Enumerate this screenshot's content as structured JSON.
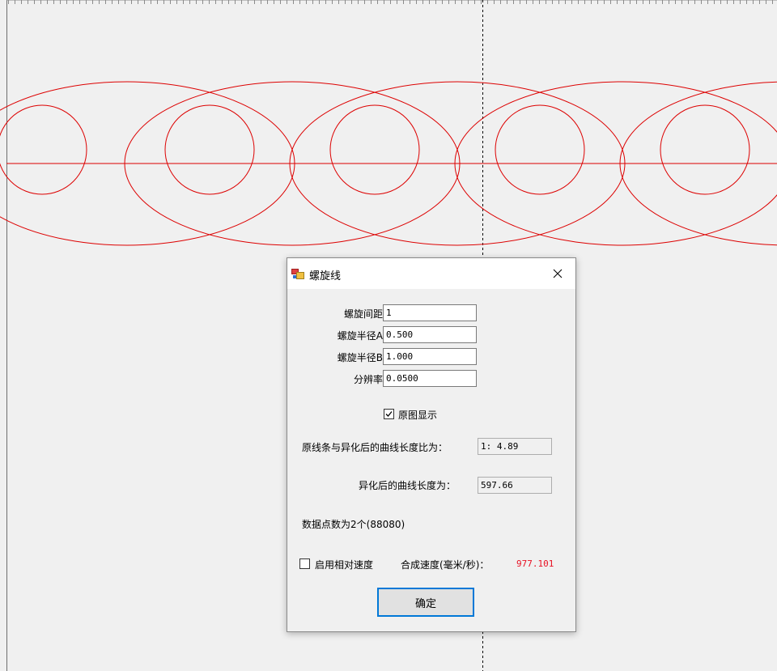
{
  "dialog": {
    "title": "螺旋线",
    "fields": [
      {
        "label": "螺旋间距",
        "value": "1"
      },
      {
        "label": "螺旋半径A",
        "value": "0.500"
      },
      {
        "label": "螺旋半径B",
        "value": "1.000"
      },
      {
        "label": "分辨率",
        "value": "0.0500"
      }
    ],
    "show_original": {
      "label": "原图显示",
      "checked": true
    },
    "ratio": {
      "label": "原线条与异化后的曲线长度比为：",
      "value": "1: 4.89"
    },
    "length": {
      "label": "异化后的曲线长度为：",
      "value": "597.66"
    },
    "points": "数据点数为2个(88080)",
    "relative_speed": {
      "label": "启用相对速度",
      "checked": false
    },
    "speed": {
      "label": "合成速度(毫米/秒)：",
      "value": "977.101",
      "value_color": "#e81123"
    },
    "ok_label": "确定"
  },
  "icons": {
    "app": "app-window-icon",
    "close": "close-icon",
    "check": "checkmark-icon"
  },
  "colors": {
    "curve": "#dd0000",
    "focus_border": "#0078d7"
  }
}
